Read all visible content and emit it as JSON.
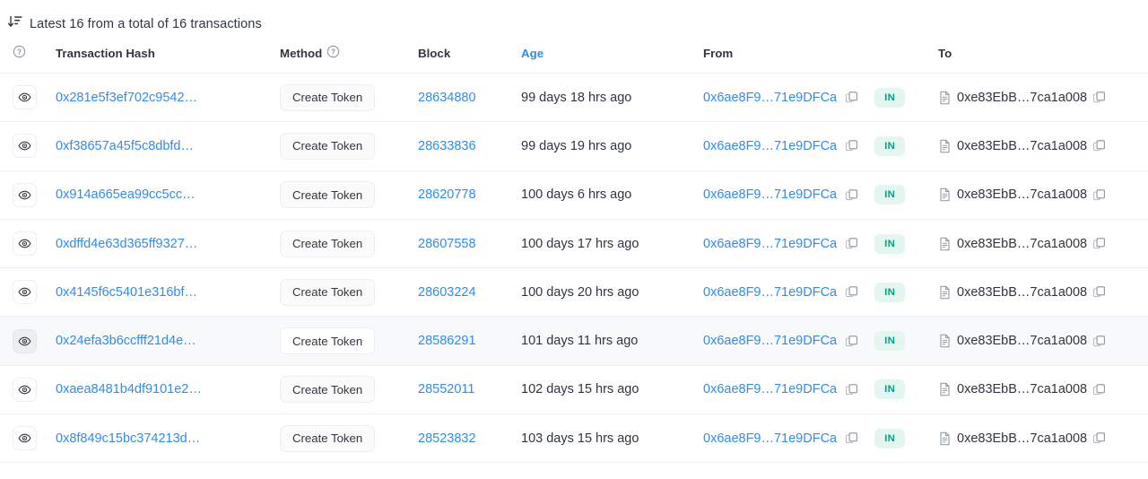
{
  "summary": {
    "sort_icon": "sort-descending-icon",
    "text": "Latest 16 from a total of 16 transactions"
  },
  "colors": {
    "link_blue": "#2e8ded",
    "text_dark": "#31353e",
    "badge_in_bg": "#e3f7f0",
    "badge_in_text": "#00a186",
    "row_hover_bg": "#f8f9fa",
    "border": "#edeff2"
  },
  "table": {
    "columns": [
      {
        "key": "eye",
        "label": "",
        "icon": "question-circle-icon",
        "sortable": false
      },
      {
        "key": "hash",
        "label": "Transaction Hash",
        "icon": "",
        "sortable": false
      },
      {
        "key": "method",
        "label": "Method",
        "icon": "question-circle-icon",
        "sortable": false
      },
      {
        "key": "block",
        "label": "Block",
        "icon": "",
        "sortable": false
      },
      {
        "key": "age",
        "label": "Age",
        "icon": "",
        "sortable": true
      },
      {
        "key": "from",
        "label": "From",
        "icon": "",
        "sortable": false
      },
      {
        "key": "to",
        "label": "To",
        "icon": "",
        "sortable": false
      }
    ],
    "icons": {
      "eye": "eye-icon",
      "copy": "copy-icon",
      "contract": "contract-document-icon"
    },
    "rows": [
      {
        "hash": "0x281e5f3ef702c9542…",
        "method": "Create Token",
        "block": "28634880",
        "age": "99 days 18 hrs ago",
        "from": "0x6ae8F9…71e9DFCa",
        "direction": "IN",
        "to": "0xe83EbB…7ca1a008",
        "hovered": false
      },
      {
        "hash": "0xf38657a45f5c8dbfd…",
        "method": "Create Token",
        "block": "28633836",
        "age": "99 days 19 hrs ago",
        "from": "0x6ae8F9…71e9DFCa",
        "direction": "IN",
        "to": "0xe83EbB…7ca1a008",
        "hovered": false
      },
      {
        "hash": "0x914a665ea99cc5cc…",
        "method": "Create Token",
        "block": "28620778",
        "age": "100 days 6 hrs ago",
        "from": "0x6ae8F9…71e9DFCa",
        "direction": "IN",
        "to": "0xe83EbB…7ca1a008",
        "hovered": false
      },
      {
        "hash": "0xdffd4e63d365ff9327…",
        "method": "Create Token",
        "block": "28607558",
        "age": "100 days 17 hrs ago",
        "from": "0x6ae8F9…71e9DFCa",
        "direction": "IN",
        "to": "0xe83EbB…7ca1a008",
        "hovered": false
      },
      {
        "hash": "0x4145f6c5401e316bf…",
        "method": "Create Token",
        "block": "28603224",
        "age": "100 days 20 hrs ago",
        "from": "0x6ae8F9…71e9DFCa",
        "direction": "IN",
        "to": "0xe83EbB…7ca1a008",
        "hovered": false
      },
      {
        "hash": "0x24efa3b6ccfff21d4e…",
        "method": "Create Token",
        "block": "28586291",
        "age": "101 days 11 hrs ago",
        "from": "0x6ae8F9…71e9DFCa",
        "direction": "IN",
        "to": "0xe83EbB…7ca1a008",
        "hovered": true
      },
      {
        "hash": "0xaea8481b4df9101e2…",
        "method": "Create Token",
        "block": "28552011",
        "age": "102 days 15 hrs ago",
        "from": "0x6ae8F9…71e9DFCa",
        "direction": "IN",
        "to": "0xe83EbB…7ca1a008",
        "hovered": false
      },
      {
        "hash": "0x8f849c15bc374213d…",
        "method": "Create Token",
        "block": "28523832",
        "age": "103 days 15 hrs ago",
        "from": "0x6ae8F9…71e9DFCa",
        "direction": "IN",
        "to": "0xe83EbB…7ca1a008",
        "hovered": false
      }
    ]
  }
}
